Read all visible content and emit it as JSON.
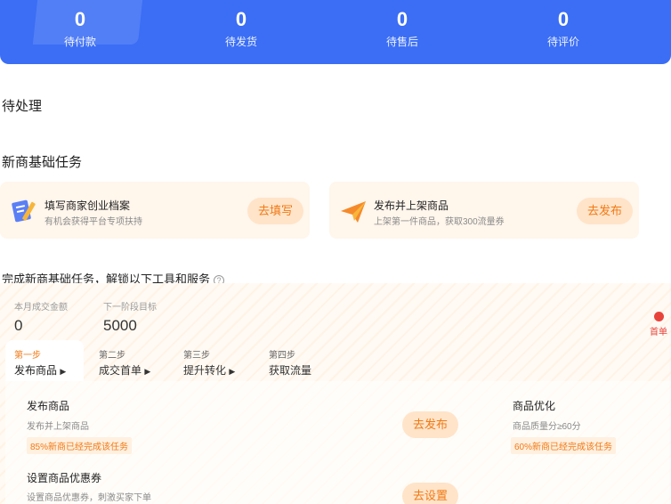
{
  "stats": [
    {
      "value": "0",
      "label": "待付款"
    },
    {
      "value": "0",
      "label": "待发货"
    },
    {
      "value": "0",
      "label": "待售后"
    },
    {
      "value": "0",
      "label": "待评价"
    }
  ],
  "pending_title": "待处理",
  "tasks_title": "新商基础任务",
  "tasks": [
    {
      "title": "填写商家创业档案",
      "subtitle": "有机会获得平台专项扶持",
      "button": "去填写",
      "icon": "document-pen-icon"
    },
    {
      "title": "发布并上架商品",
      "subtitle": "上架第一件商品，获取300流量券",
      "button": "去发布",
      "icon": "paper-plane-icon"
    }
  ],
  "unlock_title": "完成新商基础任务，解锁以下工具和服务",
  "metrics": [
    {
      "label": "本月成交金额",
      "value": "0"
    },
    {
      "label": "下一阶段目标",
      "value": "5000"
    }
  ],
  "rank_label": "首单",
  "steps": [
    {
      "no": "第一步",
      "name": "发布商品",
      "active": true
    },
    {
      "no": "第二步",
      "name": "成交首单",
      "active": false
    },
    {
      "no": "第三步",
      "name": "提升转化",
      "active": false
    },
    {
      "no": "第四步",
      "name": "获取流量",
      "active": false
    }
  ],
  "step_items": [
    {
      "title": "发布商品",
      "subtitle": "发布并上架商品",
      "badge": "85%新商已经完成该任务",
      "button": "去发布"
    },
    {
      "title": "商品优化",
      "subtitle": "商品质量分≥60分",
      "badge": "60%新商已经完成该任务"
    },
    {
      "title": "设置商品优惠券",
      "subtitle": "设置商品优惠券，刺激买家下单",
      "button": "去设置"
    }
  ],
  "colors": {
    "brand_blue": "#3b6ef5",
    "accent_orange": "#f07a16",
    "card_bg": "#fff6ec"
  }
}
